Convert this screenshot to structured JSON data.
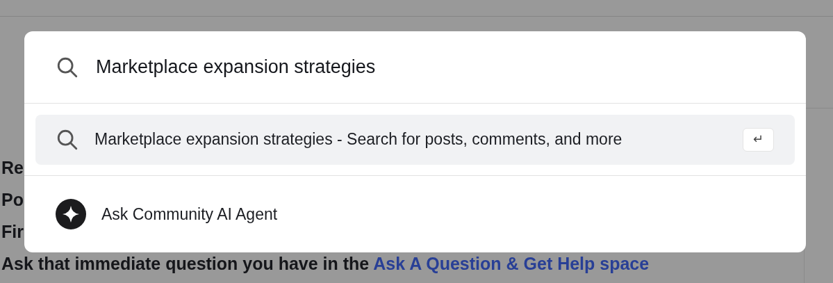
{
  "background": {
    "lines": [
      {
        "segments": [
          {
            "kind": "text",
            "text": "Re"
          }
        ]
      },
      {
        "segments": [
          {
            "kind": "text",
            "text": "Po"
          }
        ]
      },
      {
        "segments": [
          {
            "kind": "text",
            "text": "Fir"
          }
        ]
      },
      {
        "segments": [
          {
            "kind": "text",
            "text": "Ask that immediate question you have in the "
          },
          {
            "kind": "link",
            "text": "Ask A Question & Get Help space"
          }
        ]
      }
    ]
  },
  "search": {
    "value": "Marketplace expansion strategies"
  },
  "results": [
    {
      "text": "Marketplace expansion strategies - Search for posts, comments, and more",
      "selected": true,
      "key": "↵"
    }
  ],
  "agent": {
    "label": "Ask Community AI Agent"
  }
}
